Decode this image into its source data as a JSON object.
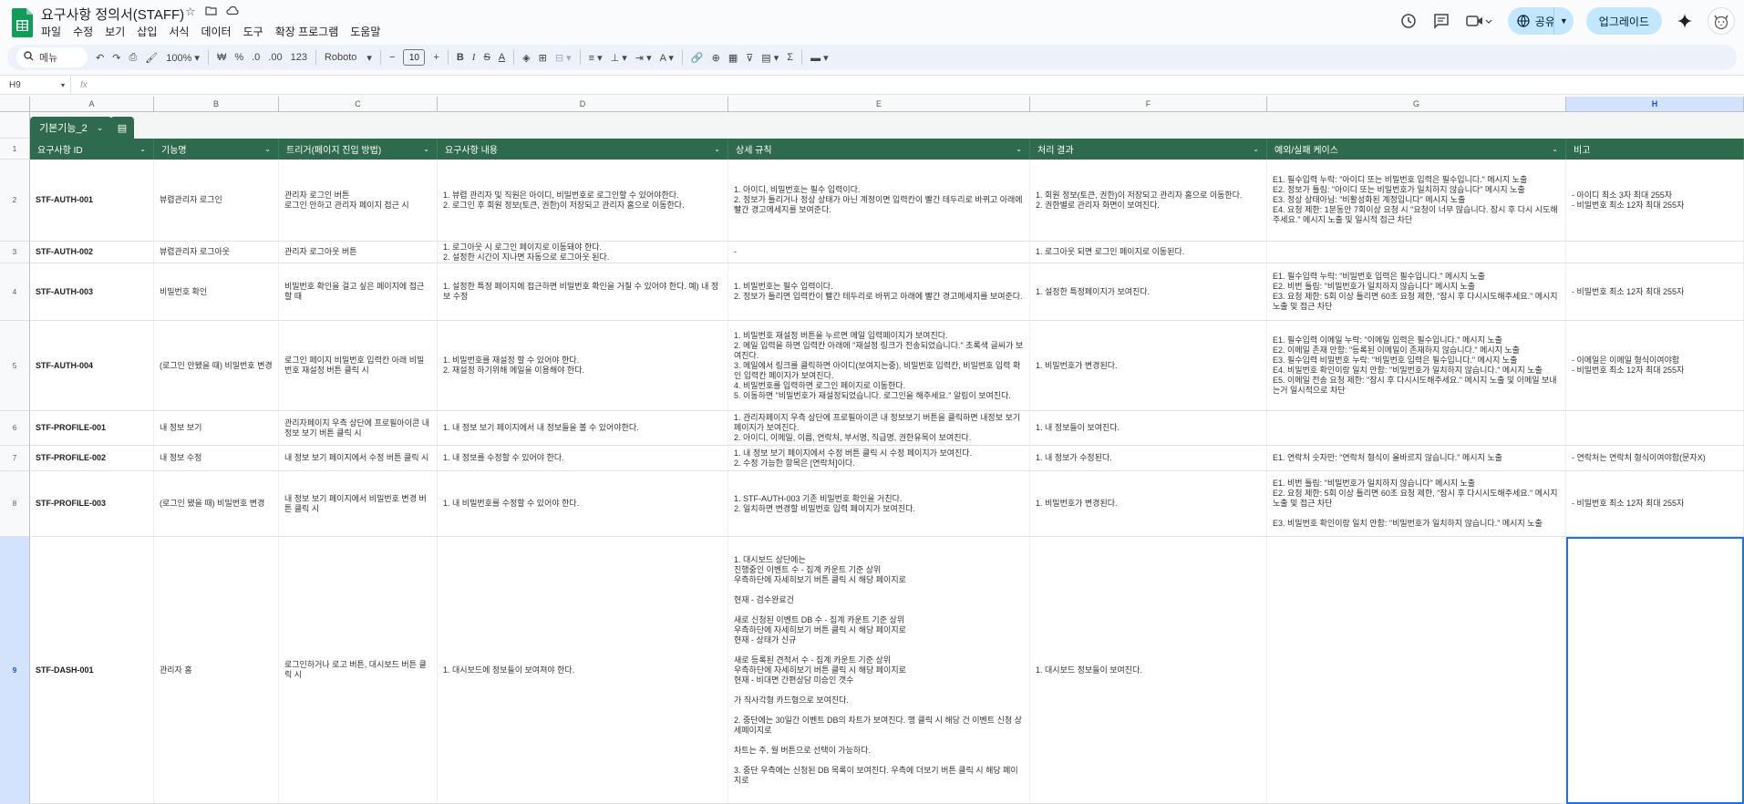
{
  "app": {
    "title": "요구사항 정의서(STAFF)",
    "menu": [
      "파일",
      "수정",
      "보기",
      "삽입",
      "서식",
      "데이터",
      "도구",
      "확장 프로그램",
      "도움말"
    ],
    "share_label": "공유",
    "upgrade_label": "업그레이드"
  },
  "toolbar": {
    "search_label": "메뉴",
    "zoom": "100%",
    "currency": "₩",
    "percent": "%",
    "dec_decrease": ".0",
    "dec_increase": ".00",
    "format_123": "123",
    "font": "Roboto",
    "font_size": "10"
  },
  "formula_bar": {
    "cell_ref": "H9",
    "fx": "fx"
  },
  "columns": [
    "A",
    "B",
    "C",
    "D",
    "E",
    "F",
    "G",
    "H"
  ],
  "table_name": "기본기능_2",
  "headers": [
    "요구사항 ID",
    "기능명",
    "트리거(페이지 진입 방법)",
    "요구사항 내용",
    "상세 규칙",
    "처리 결과",
    "예외/실패 케이스",
    "비고"
  ],
  "rows": [
    {
      "num": "2",
      "cells": [
        "STF-AUTH-001",
        "뷰렵관리자 로그인",
        "관리자 로그인 버튼\n로그인 안하고 관리자 페이지 접근 시",
        "1. 뷰렵 관리자 및 직원은 아이디, 비밀번호로 로그인할 수 있어야한다.\n2. 로그인 후 회원 정보(토큰, 권한)이 저장되고 관리자 홈으로 이동한다.",
        "1. 아이디, 비밀번호는 필수 입력이다.\n2. 정보가 틀리거나 정상 상태가 아닌 계정이면 입력칸이 빨간 테두리로 바뀌고 아래에 빨간 경고메세지를 보여준다.",
        "1. 회원 정보(토큰, 권한)이 저장되고 관리자 홈으로 이동한다.\n2. 권한별로 관리자 화면이 보여진다.",
        "E1. 필수입력 누락: \"아이디 또는 비밀번호 입력은 필수입니다.\" 메시지 노출\nE2. 정보가 틀림: \"아이디 또는 비밀번호가 일치하지 않습니다\" 메시지 노출\nE3. 정상 상태아님: \"비활성화된 계정입니다\" 메시지 노출\nE4. 요청 제한: 1분동안 7회이상 요청 시 \"요청이 너무 많습니다. 잠시 후 다시 시도해주세요.\" 메시지 노출 및 일시적 접근 차단",
        "- 아이디 최소 3자 최대 255자\n- 비밀번호 최소 12자 최대 255자"
      ]
    },
    {
      "num": "3",
      "cells": [
        "STF-AUTH-002",
        "뷰렵관리자 로그아웃",
        "관리자 로그아웃 버튼",
        "1. 로그아웃 시 로그인 페이지로 이동돼야 한다.\n2. 설정한 시간이 지나면 자동으로 로그아웃 된다.",
        "-",
        "1. 로그아웃 되면 로그인 페이지로 이동된다.",
        "",
        ""
      ]
    },
    {
      "num": "4",
      "cells": [
        "STF-AUTH-003",
        "비밀번호 확인",
        "비밀번호 확인을 걸고 싶은 페이지에 접근할 때",
        "1. 설정한 특정 페이지에 접근하면 비밀번호 확인을 거칠 수 있어야 한다. 예) 내 정보 수정",
        "1. 비밀번호는 필수 입력이다.\n2. 정보가 틀리면 입력칸이 빨간 테두리로 바뀌고 아래에 빨간 경고메세지를 보여준다.",
        "1. 설정한 특정페이지가 보여진다.",
        "E1. 필수입력 누락: \"비밀번호 입력은 필수입니다.\" 메시지 노출\nE2. 비번 틀림: \"비밀번호가 일치하지 않습니다\" 메시지 노출\nE3. 요청 제한: 5회 이상 틀리면 60초 요청 제한, \"잠시 후 다시시도해주세요.\" 메시지 노출 및 접근 차단",
        "- 비밀번호 최소 12자 최대 255자"
      ]
    },
    {
      "num": "5",
      "cells": [
        "STF-AUTH-004",
        "(로그인 안됐을 때) 비밀번호 변경",
        "로그인 페이지 비밀번호 입력칸 아래 비밀번호 재설정 버튼 클릭 시",
        "1. 비밀번호를 재설정 할 수 있어야 한다.\n2. 재설정 하기위해 메일을 이용해야 한다.",
        "1. 비밀번호 재설정 버튼을 누르면 메일 입력페이지가 보여진다.\n2. 메일 입력을 하면 입력칸 아래에 \"재설정 링크가 전송되었습니다.\" 초록색 글씨가 보여진다.\n3. 메일에서 링크를 클릭하면 아이디(보여지는중), 비밀번호 입력칸, 비밀번호 입력 확인 입력칸 페이지가 보여진다.\n4. 비밀번호를 입력하면 로그인 페이지로 이동한다.\n5. 이동하면 \"비밀번호가 재설정되었습니다. 로그인을 해주세요.\" 알림이 보여진다.",
        "1. 비밀번호가 변경된다.",
        "E1. 필수입력 이메일 누락: \"이메일 입력은 필수입니다.\" 메시지 노출\nE2. 이메일 존재 안함: \"등록된 이메일이 존재하지 않습니다.\" 메시지 노출\nE3. 필수입력 비밀번호 누락: \"비밀번호 입력은 필수입니다.\" 메시지 노출\nE4. 비밀번호 확인이랑 일치 안함: \"비밀번호가 일치하지 않습니다.\" 메시지 노출\nE5. 이메일 전송 요청 제한: \"잠시 후 다시시도해주세요.\" 메시지 노출 및 이메일 보내는거 일시적으로 차단",
        "- 이메일은 이메일 형식이여야함\n- 비밀번호 최소 12자 최대 255자"
      ]
    },
    {
      "num": "6",
      "cells": [
        "STF-PROFILE-001",
        "내 정보 보기",
        "관리자페이지 우측 상단에 프로필아이콘 내 정보 보기 버튼 클릭 시",
        "1. 내 정보 보기 페이지에서 내 정보들을 볼 수 있어야한다.",
        "1. 관리자페이지 우측 상단에 프로필아이콘 내 정보보기 버튼을 클릭하면 내정보 보기 페이지가 보여진다.\n2. 아이디, 이메일, 이름, 연락처, 부서명, 직급명, 권한유목이 보여진다.",
        "1. 내 정보들이 보여진다.",
        "",
        ""
      ]
    },
    {
      "num": "7",
      "cells": [
        "STF-PROFILE-002",
        "내 정보 수정",
        "내 정보 보기 페이지에서 수정 버튼 클릭 시",
        "1. 내 정보를 수정할 수 있어야 한다.",
        "1. 내 정보 보기 페이지에서 수정 버튼 클릭 시 수정 페이지가 보여진다.\n2. 수정 가능한 항목은 [연락처]이다.",
        "1. 내 정보가 수정된다.",
        "E1. 연락처 숫자만: \"연락처 형식이 올바르지 않습니다.\" 메시지 노출",
        "- 연락처는 연락처 형식이여야함(문자X)"
      ]
    },
    {
      "num": "8",
      "cells": [
        "STF-PROFILE-003",
        "(로그인 됐을 때) 비밀번호 변경",
        "내 정보 보기 페이지에서 비밀번호 변경 버튼 클릭 시",
        "1. 내 비밀번호를 수정할 수 있어야 한다.",
        "1. STF-AUTH-003 기존 비밀번호 확인을 거친다.\n2. 일치하면 변경할 비밀번호 입력 페이지가 보여진다.",
        "1. 비밀번호가 변경된다.",
        "E1. 비번 틀림: \"비밀번호가 일치하지 않습니다\" 메시지 노출\nE2. 요청 제한: 5회 이상 틀리면 60초 요청 제한, \"잠시 후 다시시도해주세요.\" 메시지 노출 및 접근 차단\n\nE3. 비밀번호 확인이랑 일치 안함: \"비밀번호가 일치하지 않습니다.\" 메시지 노출",
        "- 비밀번호 최소 12자 최대 255자"
      ]
    },
    {
      "num": "9",
      "cells": [
        "STF-DASH-001",
        "관리자 홈",
        "로그인하거나 로고 버튼, 대시보드 버튼 클릭 시",
        "1. 대시보드에 정보들이 보여져야 한다.",
        "1. 대시보드 상단에는\n진행중인 이벤트 수 - 집계 카운트 기준 상위\n우측하단에 자세히보기 버튼 클릭 시 해당 페이지로\n\n현재 - 검수완료건\n\n새로 신청된 이벤트 DB 수 - 집계 카운트 기준 상위\n우측하단에 자세히보기 버튼 클릭 시 해당 페이지로\n현재 - 상태가 신규\n\n새로 등록된 견적서 수 - 집계 카운트 기준 상위\n우측하단에 자세히보기 버튼 클릭 시 해당 페이지로\n현재 - 비대면 간편상담 미승인 갯수\n\n가 직사각형 카드형으로 보여진다.\n\n2. 중단에는 30일간 이벤트 DB의 차트가 보여진다. 행 클릭 시 해당 건 이벤트 신청 상세페이지로\n\n차트는 주, 월 버튼으로 선택이 가능하다.\n\n3. 중단 우측에는 신청된 DB 목록이 보여진다. 우측에 더보기 버튼 클릭 시 해당 페이지로",
        "1. 대시보드 정보들이 보여진다.",
        "",
        ""
      ]
    }
  ]
}
